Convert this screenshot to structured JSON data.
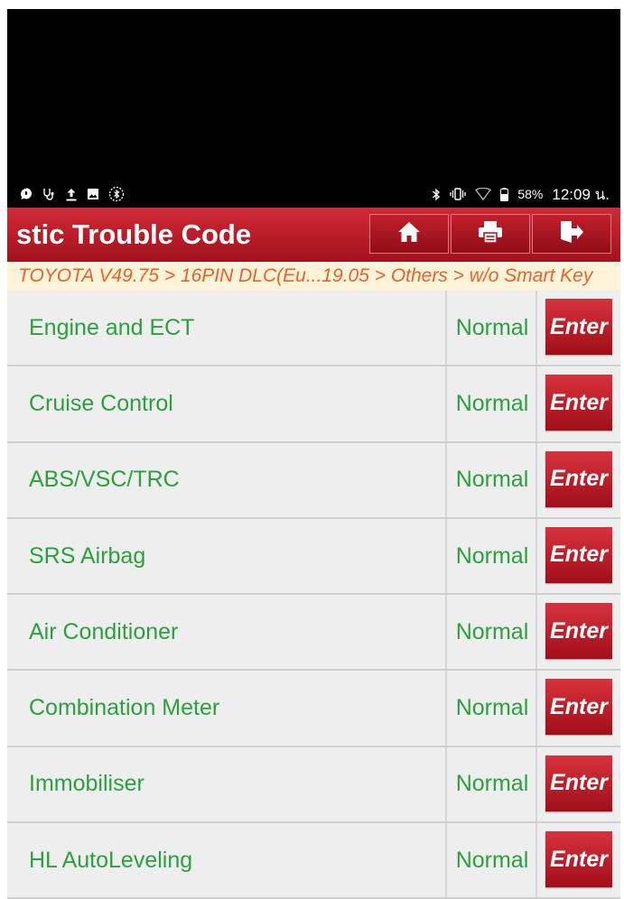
{
  "status_bar": {
    "left_icons": [
      "chat-bubble-icon",
      "stethoscope-icon",
      "upload-icon",
      "image-icon",
      "bluetooth-circle-icon"
    ],
    "right_icons": [
      "bluetooth-icon",
      "vibrate-icon",
      "wifi-icon",
      "battery-icon"
    ],
    "battery_percent": "58%",
    "time": "12:09 น."
  },
  "header": {
    "title": "stic Trouble Code",
    "buttons": [
      {
        "name": "home",
        "icon": "home-icon"
      },
      {
        "name": "print",
        "icon": "printer-icon"
      },
      {
        "name": "exit",
        "icon": "exit-icon"
      }
    ]
  },
  "breadcrumb": "TOYOTA V49.75 > 16PIN DLC(Eu...19.05 > Others > w/o Smart Key",
  "systems": [
    {
      "name": "Engine and ECT",
      "status": "Normal",
      "action": "Enter"
    },
    {
      "name": "Cruise Control",
      "status": "Normal",
      "action": "Enter"
    },
    {
      "name": "ABS/VSC/TRC",
      "status": "Normal",
      "action": "Enter"
    },
    {
      "name": "SRS Airbag",
      "status": "Normal",
      "action": "Enter"
    },
    {
      "name": "Air Conditioner",
      "status": "Normal",
      "action": "Enter"
    },
    {
      "name": "Combination Meter",
      "status": "Normal",
      "action": "Enter"
    },
    {
      "name": "Immobiliser",
      "status": "Normal",
      "action": "Enter"
    },
    {
      "name": "HL AutoLeveling",
      "status": "Normal",
      "action": "Enter"
    }
  ],
  "colors": {
    "header_red": "#c31f2a",
    "status_green": "#2aa13c",
    "breadcrumb_orange": "#e8632b",
    "breadcrumb_bg": "#fdf3d9"
  }
}
